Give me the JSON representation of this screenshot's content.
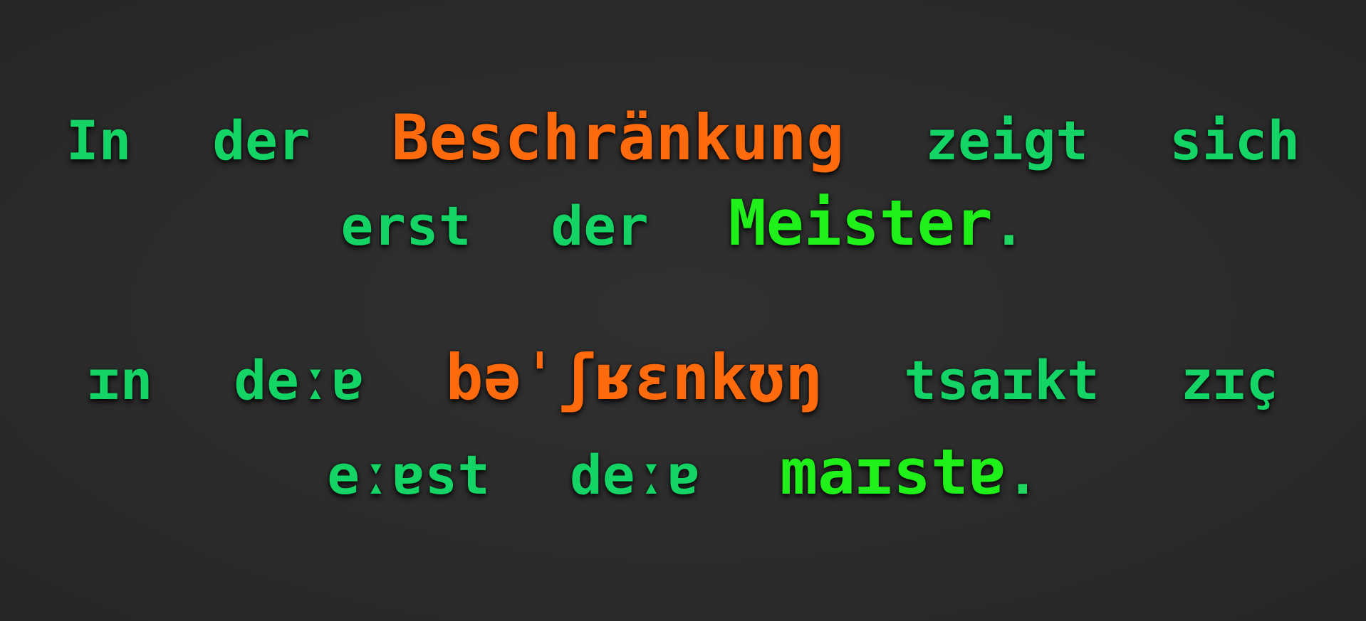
{
  "sentence": {
    "line1": [
      "In",
      "der",
      "Beschränkung",
      "zeigt",
      "sich"
    ],
    "line2": [
      "erst",
      "der",
      "Meister",
      "."
    ]
  },
  "ipa": {
    "line1": [
      "ɪn",
      "deːɐ",
      "bəˈʃʁɛnkʊŋ",
      "tsaɪkt",
      "zɪç"
    ],
    "line2": [
      "eːɐst",
      "deːɐ",
      "maɪstɐ",
      "."
    ]
  },
  "colors": {
    "background": "#2c2c2c",
    "normal_word": "#14d466",
    "highlight_orange": "#ff6a0d",
    "highlight_green": "#1ff01a"
  }
}
